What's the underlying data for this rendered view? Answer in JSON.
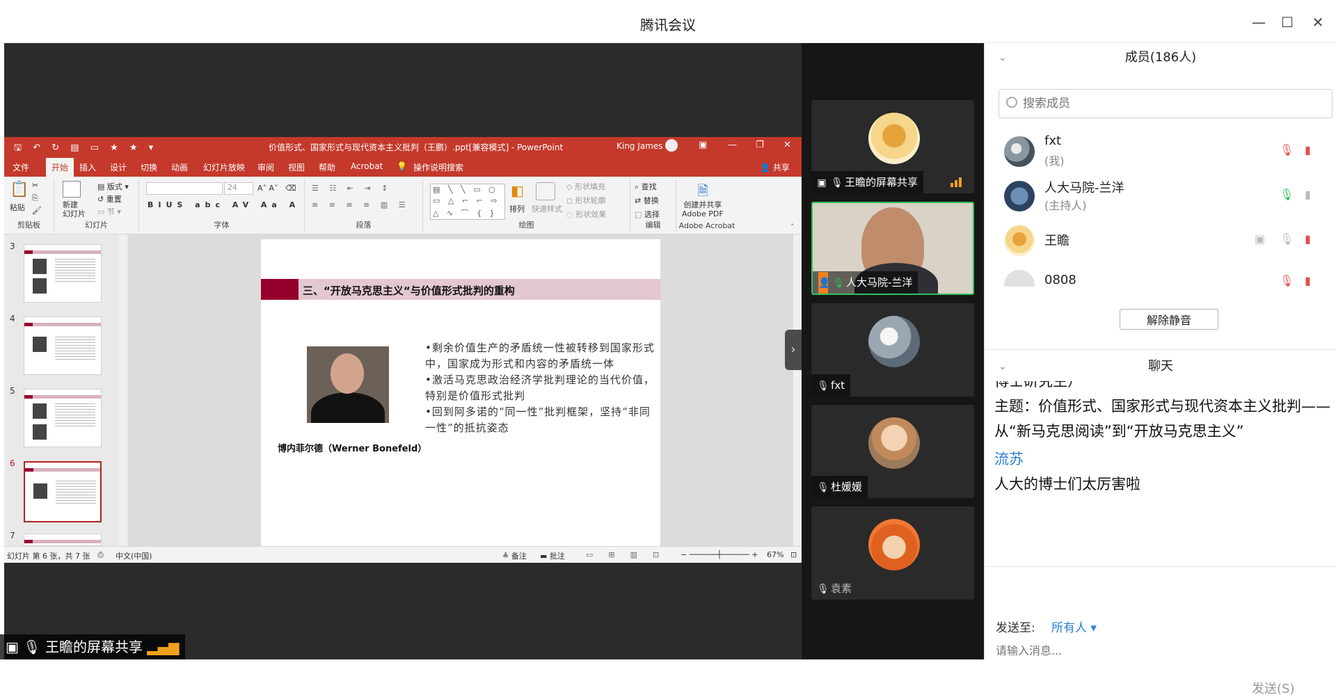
{
  "app": {
    "title": "腾讯会议"
  },
  "ppt": {
    "doc_title": "价值形式、国家形式与现代资本主义批判（王鹏）.ppt[兼容模式] - PowerPoint",
    "user": "King James",
    "tabs": [
      "文件",
      "开始",
      "插入",
      "设计",
      "切换",
      "动画",
      "幻灯片放映",
      "审阅",
      "视图",
      "帮助",
      "Acrobat",
      "操作说明搜索"
    ],
    "share_label": "共享",
    "ribbon": {
      "clipboard": {
        "label": "剪贴板",
        "paste": "粘贴"
      },
      "slides": {
        "label": "幻灯片",
        "new_slide": "新建\n幻灯片",
        "layout": "版式",
        "reset": "重置",
        "section": "节"
      },
      "font": {
        "label": "字体",
        "size": "24"
      },
      "paragraph": {
        "label": "段落"
      },
      "drawing": {
        "label": "绘图",
        "arrange": "排列",
        "quick_styles": "快速样式",
        "fill": "形状填充",
        "outline": "形状轮廓",
        "effects": "形状效果"
      },
      "editing": {
        "label": "编辑",
        "find": "查找",
        "replace": "替换",
        "select": "选择"
      },
      "acrobat": {
        "label": "Adobe Acrobat",
        "create_share": "创建并共享\nAdobe PDF"
      }
    },
    "thumbnails": [
      {
        "number": "3"
      },
      {
        "number": "4"
      },
      {
        "number": "5"
      },
      {
        "number": "6",
        "selected": true
      },
      {
        "number": "7"
      }
    ],
    "slide": {
      "title": "三、“开放马克思主义“与价值形式批判的重构",
      "caption": "博内菲尔德（Werner Bonefeld）",
      "bullets": [
        "•剩余价值生产的矛盾统一性被转移到国家形式中，国家成为形式和内容的矛盾统一体",
        "•激活马克思政治经济学批判理论的当代价值，特别是价值形式批判",
        "•回到阿多诺的“同一性”批判框架，坚持“非同一性”的抵抗姿态"
      ]
    },
    "status": {
      "slide_info": "幻灯片 第 6 张，共 7 张",
      "language": "中文(中国)",
      "notes": "备注",
      "comments": "批注",
      "zoom": "67%"
    }
  },
  "videos": [
    {
      "name": "王瞻的屏幕共享",
      "type": "share"
    },
    {
      "name": "人大马院-兰洋",
      "type": "camera",
      "active": true
    },
    {
      "name": "fxt",
      "type": "avatar",
      "muted": true
    },
    {
      "name": "杜媛媛",
      "type": "avatar",
      "muted": true
    },
    {
      "name": "袁素",
      "type": "avatar",
      "muted": true
    }
  ],
  "members": {
    "title": "成员(186人)",
    "search_placeholder": "搜索成员",
    "list": [
      {
        "name": "fxt",
        "role": "(我)"
      },
      {
        "name": "人大马院-兰洋",
        "role": "(主持人)"
      },
      {
        "name": "王瞻",
        "role": ""
      },
      {
        "name": "0808",
        "role": ""
      }
    ],
    "unmute_all": "解除静音"
  },
  "chat": {
    "title": "聊天",
    "partial_line": "博士研究生）",
    "topic_line": "主题：价值形式、国家形式与现代资本主义批判——从“新马克思阅读”到“开放马克思主义”",
    "sender": "流苏",
    "message": "人大的博士们太厉害啦",
    "send_to_label": "发送至:",
    "send_to_value": "所有人 ▾",
    "input_placeholder": "请输入消息...",
    "send_button": "发送(S)"
  },
  "share_badge": {
    "text": "王瞻的屏幕共享"
  },
  "colors": {
    "ppt_red": "#c4392b",
    "slide_maroon": "#96002c",
    "active_green": "#2fc25b",
    "link_blue": "#2b7fd4"
  }
}
